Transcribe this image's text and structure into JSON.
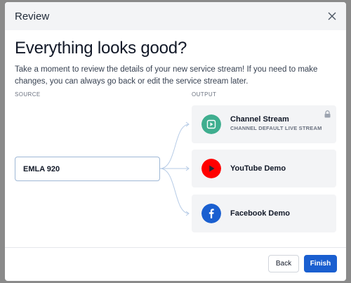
{
  "modal": {
    "title": "Review",
    "headline": "Everything looks good?",
    "description": "Take a moment to review the details of your new service stream! If you need to make changes, you can always go back or edit the service stream later."
  },
  "labels": {
    "source": "SOURCE",
    "output": "OUTPUT"
  },
  "source": {
    "name": "EMLA 920"
  },
  "outputs": [
    {
      "name": "Channel Stream",
      "subtitle": "CHANNEL DEFAULT LIVE STREAM",
      "icon": "play-square-icon",
      "color": "#3fae8f",
      "locked": true
    },
    {
      "name": "YouTube Demo",
      "subtitle": "",
      "icon": "youtube-play-icon",
      "color": "#ff0000",
      "locked": false
    },
    {
      "name": "Facebook Demo",
      "subtitle": "",
      "icon": "facebook-icon",
      "color": "#1a5fd0",
      "locked": false
    }
  ],
  "footer": {
    "back_label": "Back",
    "finish_label": "Finish"
  },
  "colors": {
    "primary": "#1a5fd0",
    "connector": "#b6cbe6",
    "card_bg": "#f3f4f6",
    "overlay": "#8a8a8a"
  }
}
